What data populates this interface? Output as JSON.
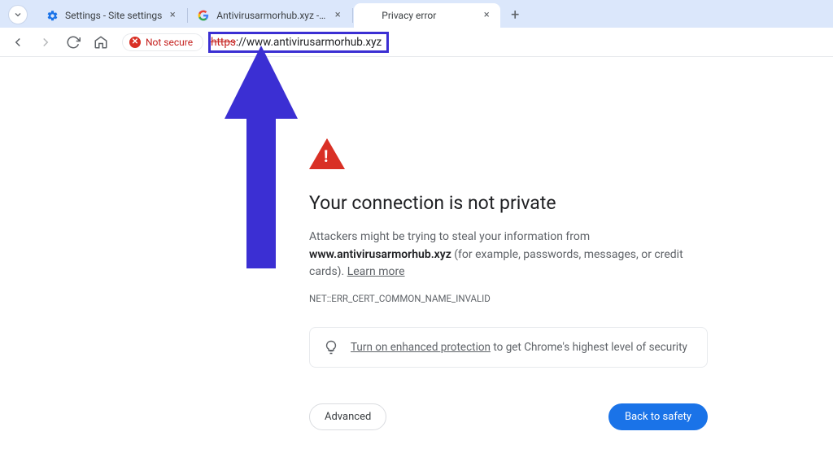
{
  "tabs": [
    {
      "title": "Settings - Site settings",
      "favicon": "gear",
      "active": false
    },
    {
      "title": "Antivirusarmorhub.xyz - Google",
      "favicon": "google",
      "active": false
    },
    {
      "title": "Privacy error",
      "favicon": "none",
      "active": true
    }
  ],
  "toolbar": {
    "security_label": "Not secure",
    "url_protocol": "https",
    "url_rest": "://www.antivirusarmorhub.xyz"
  },
  "error": {
    "heading": "Your connection is not private",
    "body_prefix": "Attackers might be trying to steal your information from ",
    "body_domain": "www.antivirusarmorhub.xyz",
    "body_suffix": " (for example, passwords, messages, or credit cards). ",
    "learn_more": "Learn more",
    "code": "NET::ERR_CERT_COMMON_NAME_INVALID",
    "tip_link": "Turn on enhanced protection",
    "tip_suffix": " to get Chrome's highest level of security",
    "advanced_label": "Advanced",
    "back_label": "Back to safety"
  },
  "annotation": {
    "color": "#3b2fd3"
  }
}
